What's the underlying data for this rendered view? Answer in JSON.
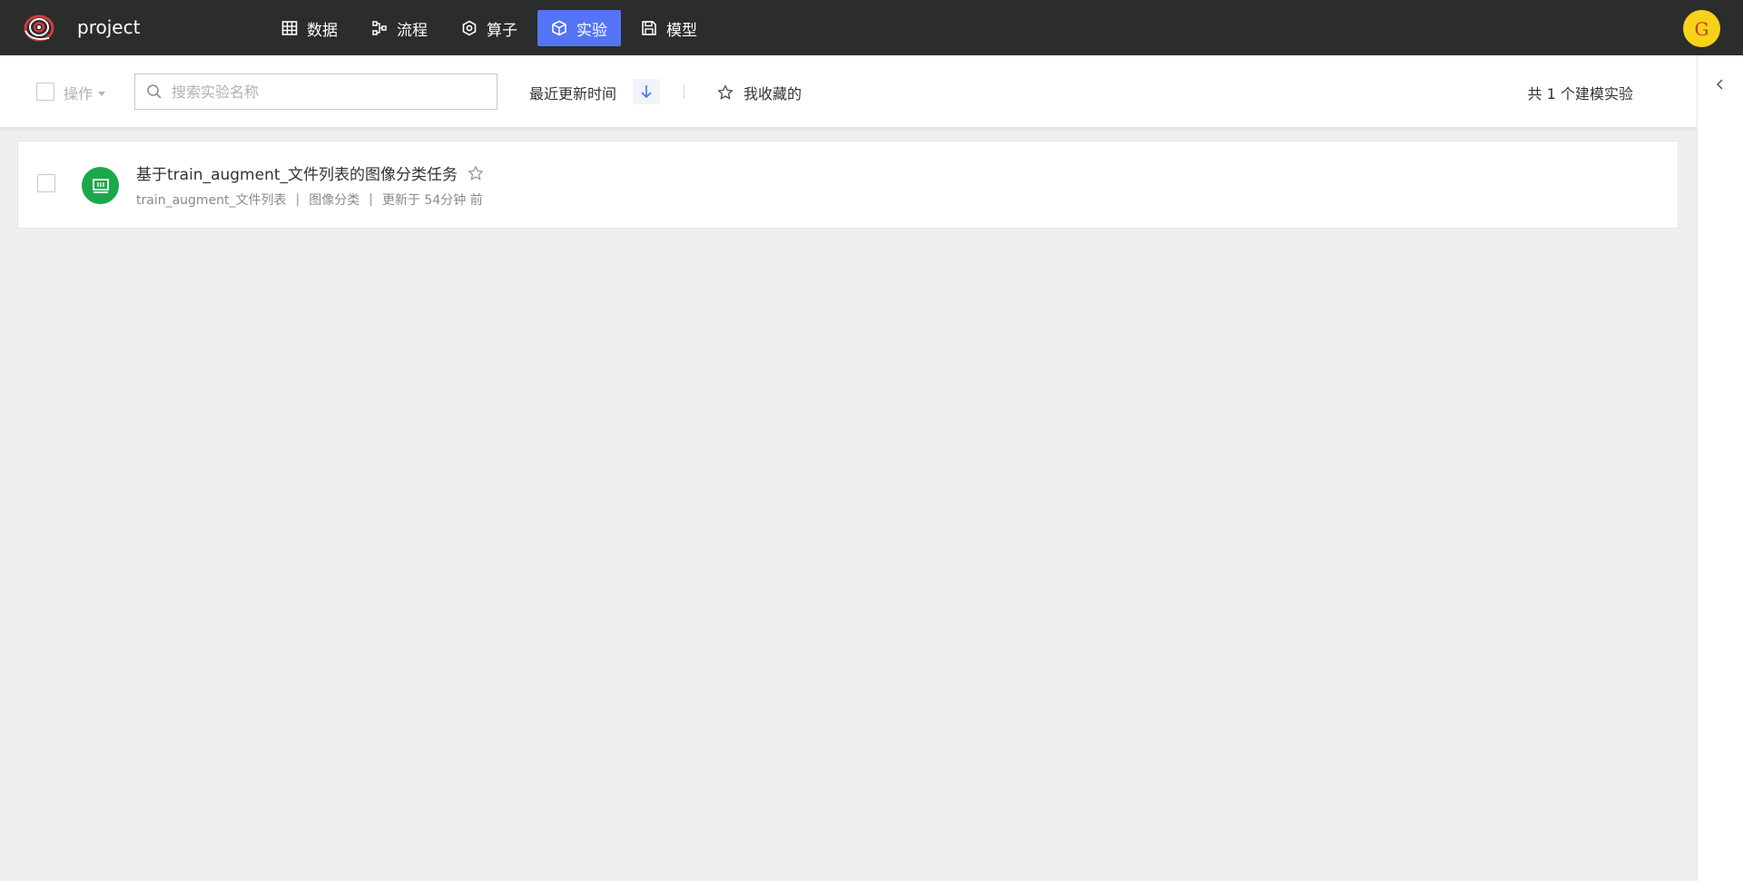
{
  "app": {
    "project_name": "project",
    "avatar_letter": "G",
    "accent_color": "#5374f4"
  },
  "nav": {
    "items": [
      {
        "label": "数据",
        "icon": "table-grid-icon"
      },
      {
        "label": "流程",
        "icon": "workflow-icon"
      },
      {
        "label": "算子",
        "icon": "hexagon-operator-icon"
      },
      {
        "label": "实验",
        "icon": "cube-icon",
        "active": true
      },
      {
        "label": "模型",
        "icon": "save-model-icon"
      }
    ]
  },
  "toolbar": {
    "ops_label": "操作",
    "search_placeholder": "搜索实验名称",
    "sort_label": "最近更新时间",
    "sort_direction": "descending",
    "favorites_label": "我收藏的",
    "total_text": "共 1 个建模实验"
  },
  "experiments": [
    {
      "title": "基于train_augment_文件列表的图像分类任务",
      "dataset": "train_augment_文件列表",
      "task_type": "图像分类",
      "updated": "更新于 54分钟 前",
      "icon_color": "#1aa84a"
    }
  ]
}
